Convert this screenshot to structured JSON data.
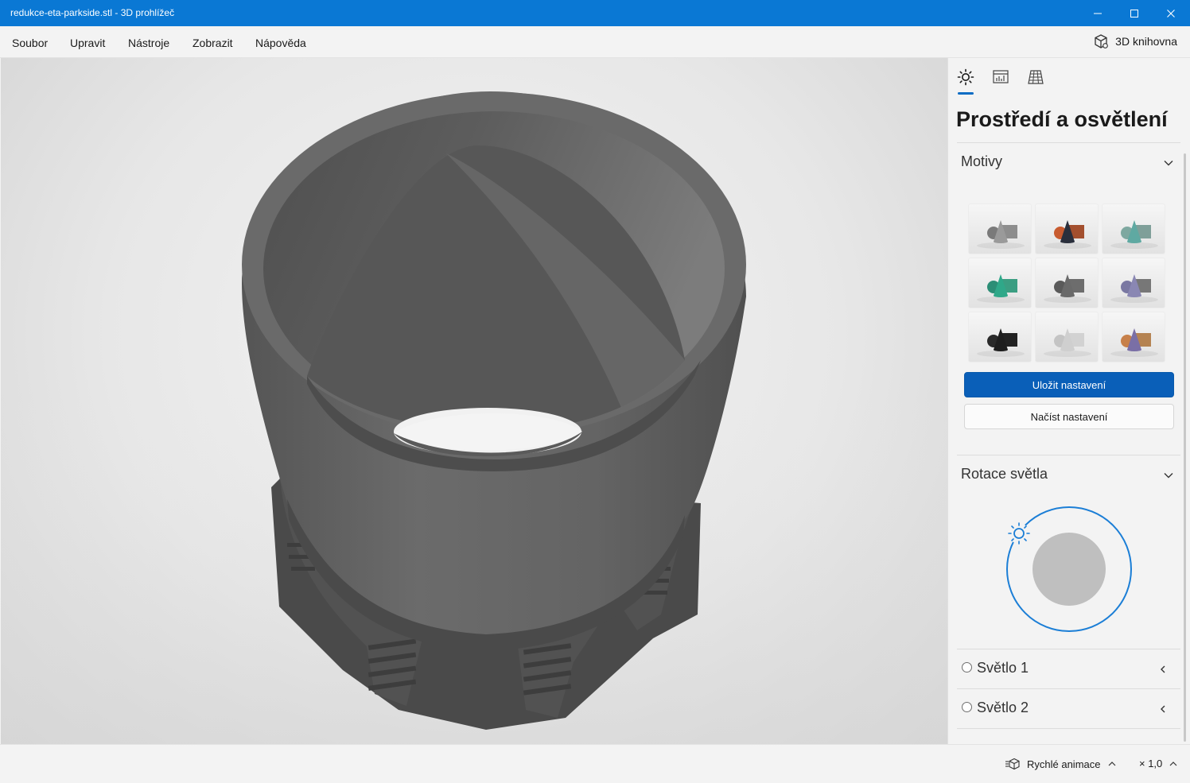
{
  "window": {
    "title": "redukce-eta-parkside.stl - 3D prohlížeč",
    "controls": [
      "minimize-icon",
      "maximize-icon",
      "close-icon"
    ],
    "accent": "#0a78d4"
  },
  "menu": {
    "items": [
      "Soubor",
      "Upravit",
      "Nástroje",
      "Zobrazit",
      "Nápověda"
    ],
    "library_label": "3D knihovna",
    "library_icon": "cube-icon"
  },
  "panel": {
    "tabs": [
      {
        "icon": "sun-icon",
        "selected": true
      },
      {
        "icon": "stats-icon",
        "selected": false
      },
      {
        "icon": "grid-icon",
        "selected": false
      }
    ],
    "title": "Prostředí a osvětlení",
    "themes": {
      "title": "Motivy",
      "items": [
        {
          "cone": "#9a9a9a",
          "box": "#8d8d8d",
          "ball": "#7a7a7a"
        },
        {
          "cone": "#2a2f3c",
          "box": "#a34f2e",
          "ball": "#c85b2f"
        },
        {
          "cone": "#5fa9a2",
          "box": "#7f9f99",
          "ball": "#7ea8a0"
        },
        {
          "cone": "#2fa889",
          "box": "#3b9e82",
          "ball": "#2c8e76"
        },
        {
          "cone": "#6a6a6a",
          "box": "#6d6d6d",
          "ball": "#5a5a5a"
        },
        {
          "cone": "#8a87b3",
          "box": "#777777",
          "ball": "#7a78a2"
        },
        {
          "cone": "#1e1e1e",
          "box": "#222222",
          "ball": "#2a2a2a"
        },
        {
          "cone": "#cfcfcf",
          "box": "#d2d2d2",
          "ball": "#c4c4c4"
        },
        {
          "cone": "#7a6fa6",
          "box": "#b58352",
          "ball": "#c7804a"
        }
      ],
      "save_label": "Uložit nastavení",
      "load_label": "Načíst nastavení"
    },
    "light_rotation": {
      "title": "Rotace světla"
    },
    "lights": [
      {
        "label": "Světlo 1"
      },
      {
        "label": "Světlo 2"
      }
    ]
  },
  "status": {
    "animation_label": "Rychlé animace",
    "speed_label": "× 1,0"
  }
}
